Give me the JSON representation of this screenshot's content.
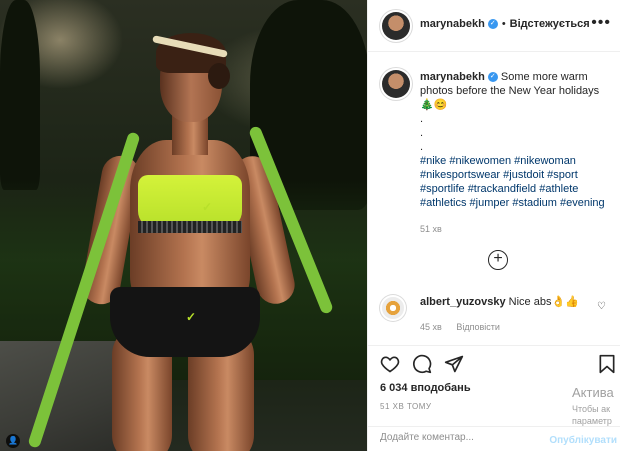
{
  "header": {
    "username": "marynabekh",
    "separator": "•",
    "follow_label": "Відстежується",
    "more_icon": "more-icon"
  },
  "caption": {
    "username": "marynabekh",
    "text": "Some more warm photos before the New Year holidays",
    "emoji": "🎄😊",
    "dots": [
      ".",
      ".",
      "."
    ],
    "hashtags": "#nike #nikewomen #nikewoman #nikesportswear #justdoit #sport #sportlife #trackandfield #athlete #athletics #jumper #stadium #evening",
    "time": "51 хв"
  },
  "load_more_icon": "plus-circle-icon",
  "comment": {
    "username": "albert_yuzovsky",
    "text": "Nice abs👌👍",
    "time": "45 хв",
    "reply_label": "Відповісти"
  },
  "actions": {
    "likes": "6 034 вподобань",
    "timestamp": "51 ХВ ТОМУ"
  },
  "composer": {
    "placeholder": "Додайте коментар...",
    "post_label": "Опублікувати"
  },
  "watermark": {
    "line1": "Актива",
    "line2": "Чтобы ак",
    "line3": "параметр"
  },
  "colors": {
    "verified": "#3897f0",
    "link": "#00376b",
    "muted": "#8e8e8e",
    "post_disabled": "#b2dffc"
  }
}
